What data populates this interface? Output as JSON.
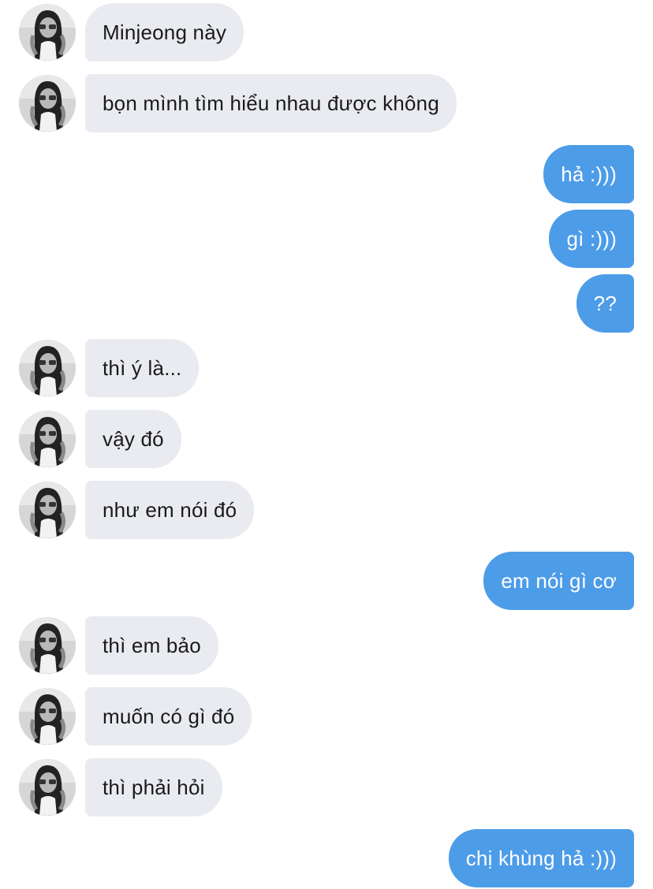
{
  "conversation": {
    "contact_avatar": "contact-avatar-photo",
    "colors": {
      "incoming_bubble": "#e9ebf0",
      "outgoing_bubble": "#4d9ce8",
      "incoming_text": "#1a1a1a",
      "outgoing_text": "#ffffff",
      "background": "#ffffff"
    },
    "messages": [
      {
        "from": "them",
        "text": "Minjeong này"
      },
      {
        "from": "them",
        "text": "bọn mình tìm hiểu nhau được không"
      },
      {
        "from": "me",
        "text": "hả :)))"
      },
      {
        "from": "me",
        "text": "gì :)))"
      },
      {
        "from": "me",
        "text": "??"
      },
      {
        "from": "them",
        "text": "thì ý là..."
      },
      {
        "from": "them",
        "text": "vậy đó"
      },
      {
        "from": "them",
        "text": "như em nói đó"
      },
      {
        "from": "me",
        "text": "em nói gì cơ"
      },
      {
        "from": "them",
        "text": "thì em bảo"
      },
      {
        "from": "them",
        "text": "muốn có gì đó"
      },
      {
        "from": "them",
        "text": "thì phải hỏi"
      },
      {
        "from": "me",
        "text": "chị khùng hả :)))"
      }
    ]
  }
}
